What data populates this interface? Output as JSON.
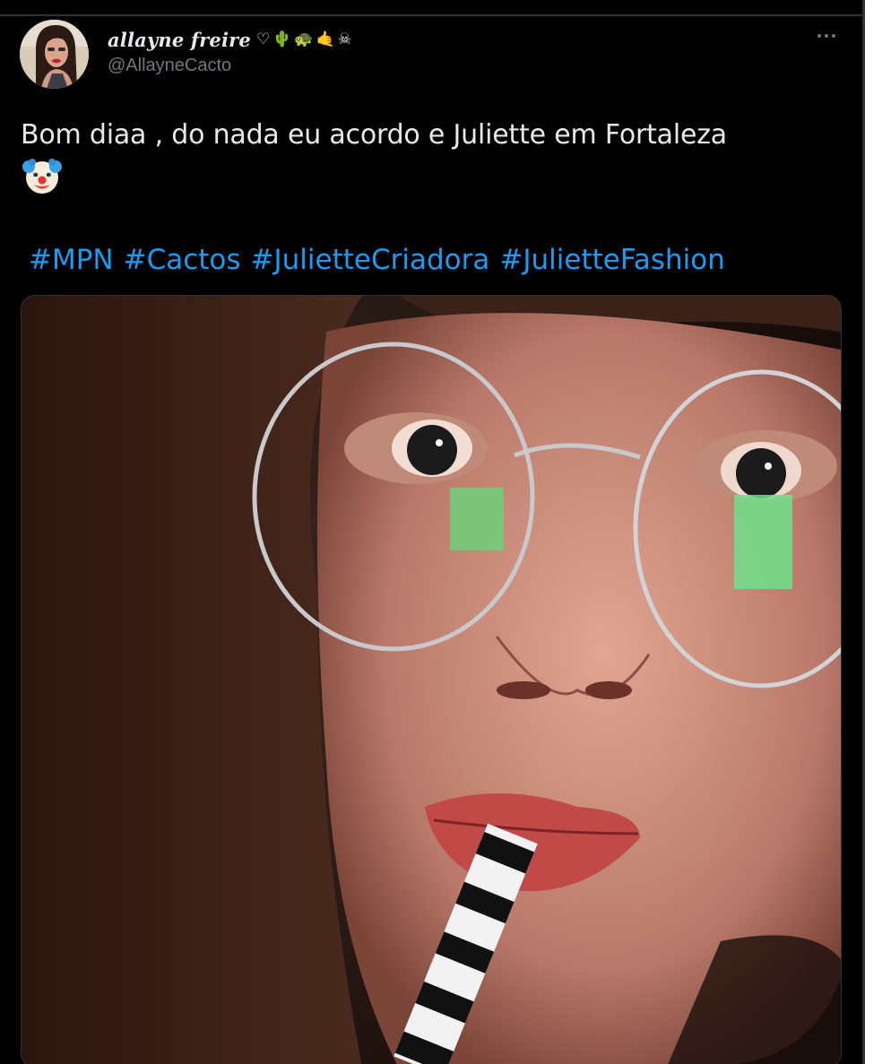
{
  "colors": {
    "background": "#000000",
    "primary_text": "#e7e9ea",
    "secondary_text": "#71767b",
    "link": "#1d9bf0",
    "divider": "#2f3336"
  },
  "author": {
    "display_name": "allayne freire",
    "name_emojis": [
      "♡",
      "🌵",
      "🐢",
      "🤙",
      "☠"
    ],
    "handle": "@AllayneCacto",
    "avatar_icon": "profile-avatar"
  },
  "more_menu": {
    "icon": "more-horizontal-icon"
  },
  "tweet": {
    "text": "Bom diaa , do nada eu acordo e Juliette em Fortaleza",
    "emoji": "🤡",
    "emoji_icon": "clown-face-emoji",
    "hashtags": [
      "#MPN",
      "#Cactos",
      "#JulietteCriadora",
      "#JulietteFashion"
    ]
  },
  "media": {
    "icon": "selfie-photo"
  }
}
